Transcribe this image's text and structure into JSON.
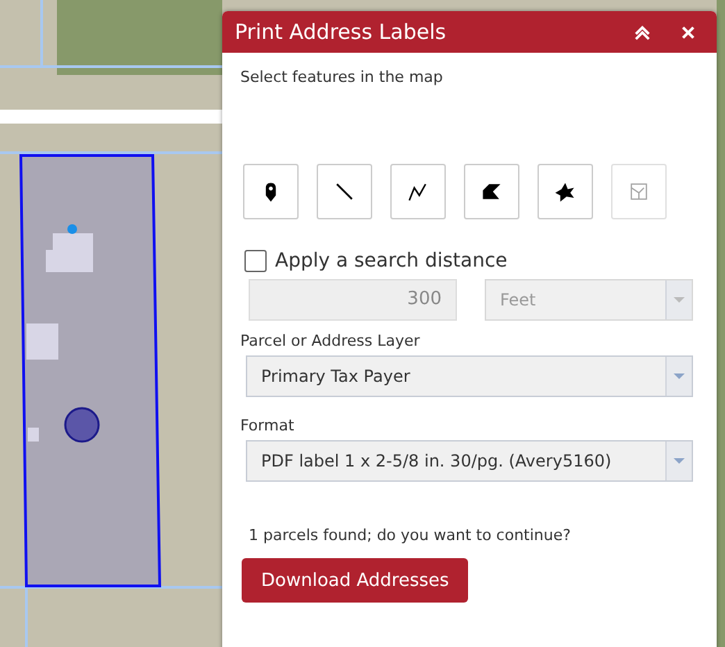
{
  "panel": {
    "title": "Print Address Labels",
    "instruction": "Select features in the map",
    "tools": [
      {
        "kind": "point",
        "disabled": false
      },
      {
        "kind": "line",
        "disabled": false
      },
      {
        "kind": "polyline",
        "disabled": false
      },
      {
        "kind": "polygon",
        "disabled": false
      },
      {
        "kind": "freehand",
        "disabled": false
      },
      {
        "kind": "parcel",
        "disabled": true
      }
    ],
    "search_distance": {
      "label": "Apply a search distance",
      "checked": false,
      "value": "300",
      "unit": "Feet"
    },
    "layer": {
      "label": "Parcel or Address Layer",
      "value": "Primary Tax Payer"
    },
    "format": {
      "label": "Format",
      "value": "PDF label 1 x 2-5/8 in. 30/pg. (Avery5160)"
    },
    "message": "1 parcels found; do you want to continue?",
    "button": "Download Addresses"
  }
}
